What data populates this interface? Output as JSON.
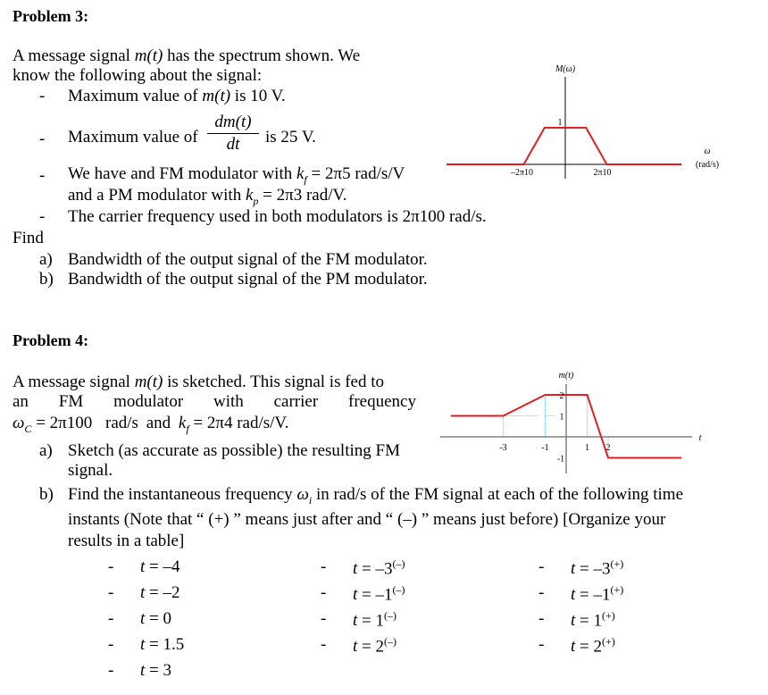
{
  "problem3": {
    "heading": "Problem 3:",
    "intro_line1": "A message signal m(t) has the spectrum shown. We",
    "intro_line2": "know the following about the signal:",
    "bullet1": {
      "pre": "Maximum value of ",
      "var": "m(t)",
      "post": " is 10 V."
    },
    "bullet2": {
      "pre": "Maximum value of",
      "num": "dm(t)",
      "den": "dt",
      "post": "is 25 V."
    },
    "bullet3_line1": {
      "pre": "We have and FM modulator with ",
      "var": "k",
      "sub": "f",
      "post": " = 2π5 rad/s/V"
    },
    "bullet3_line2": {
      "pre": "and a PM modulator with ",
      "var": "k",
      "sub": "p",
      "post": " = 2π3 rad/V."
    },
    "bullet4": "The carrier frequency used in both modulators is 2π100 rad/s.",
    "find_label": "Find",
    "questions": [
      {
        "label": "a)",
        "text": "Bandwidth of the output signal of the FM modulator."
      },
      {
        "label": "b)",
        "text": "Bandwidth of the output signal of the PM modulator."
      }
    ]
  },
  "problem4": {
    "heading": "Problem 4:",
    "intro_line1": "A message signal m(t) is sketched. This signal is fed to",
    "intro_line2_words": [
      "an",
      "FM",
      "modulator",
      "with",
      "carrier",
      "frequency"
    ],
    "intro_line3": {
      "wc": "ω",
      "wc_sub": "C",
      "wc_val": " = 2π100",
      "unit": "rad/s",
      "and": "and",
      "kf": "k",
      "kf_sub": "f",
      "kf_val": " = 2π4 rad/s/V."
    },
    "qa_label": "a)",
    "qa_line1": "Sketch (as accurate as possible) the resulting FM",
    "qa_line2": "signal.",
    "qb_label": "b)",
    "qb_line1_pre": "Find the instantaneous frequency ",
    "qb_line1_var": "ω",
    "qb_line1_sub": "i",
    "qb_line1_post": " in rad/s of the FM signal at each of the following time",
    "qb_line2": "instants (Note that “ (+) ” means just after and “ (–) ” means just before) [Organize your",
    "qb_line3": "results in a table]",
    "time_instants": {
      "col1": [
        {
          "base": "–4",
          "sup": ""
        },
        {
          "base": "–2",
          "sup": ""
        },
        {
          "base": "0",
          "sup": ""
        },
        {
          "base": "1.5",
          "sup": ""
        },
        {
          "base": "3",
          "sup": ""
        }
      ],
      "col2": [
        {
          "base": "–3",
          "sup": "(–)"
        },
        {
          "base": "–1",
          "sup": "(–)"
        },
        {
          "base": "1",
          "sup": "(–)"
        },
        {
          "base": "2",
          "sup": "(–)"
        }
      ],
      "col3": [
        {
          "base": "–3",
          "sup": "(+)"
        },
        {
          "base": "–1",
          "sup": "(+)"
        },
        {
          "base": "1",
          "sup": "(+)"
        },
        {
          "base": "2",
          "sup": "(+)"
        }
      ]
    }
  },
  "chart_data": [
    {
      "type": "line",
      "title": "M(ω)",
      "xlabel": "ω (rad/s)",
      "ylabel": "M(ω)",
      "x_tick_labels": [
        "–2π10",
        "2π10"
      ],
      "y_tick_labels": [
        "1"
      ],
      "x_units": "2π rad/s",
      "points": [
        [
          -30,
          0
        ],
        [
          -10,
          0
        ],
        [
          -5,
          1
        ],
        [
          5,
          1
        ],
        [
          10,
          0
        ],
        [
          28,
          0
        ]
      ],
      "xlim": [
        -30,
        30
      ],
      "ylim": [
        0,
        1.5
      ],
      "grid": false,
      "line_color": "#e02020",
      "axis_color": "#808080"
    },
    {
      "type": "line",
      "title": "m(t)",
      "xlabel": "t",
      "ylabel": "m(t)",
      "x_tick_labels": [
        "-3",
        "-1",
        "1",
        "2"
      ],
      "y_tick_labels": [
        "2",
        "1",
        "-1"
      ],
      "points": [
        [
          -5.5,
          1
        ],
        [
          -3,
          1
        ],
        [
          -1,
          2
        ],
        [
          1,
          2
        ],
        [
          2,
          -1
        ],
        [
          5.5,
          -1
        ]
      ],
      "guides": [
        [
          -3,
          1
        ],
        [
          -1,
          2
        ],
        [
          1,
          2
        ],
        [
          2,
          -1
        ]
      ],
      "xlim": [
        -6,
        6
      ],
      "ylim": [
        -1.5,
        2.5
      ],
      "grid": false,
      "line_color": "#e02020",
      "axis_color": "#808080",
      "guide_color": "#6ec6ff"
    }
  ]
}
